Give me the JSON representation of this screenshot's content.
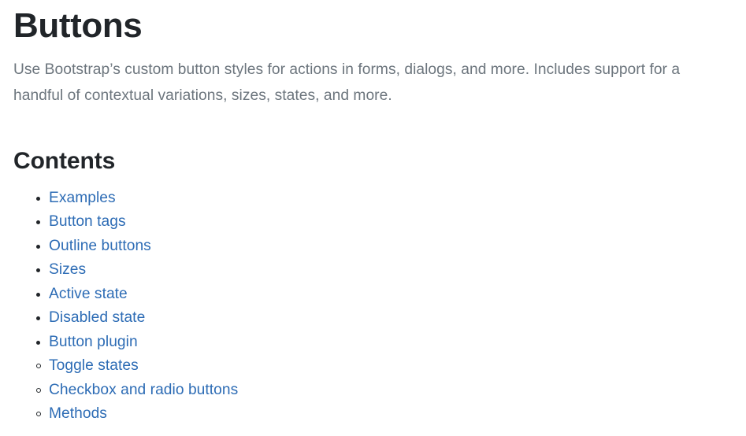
{
  "page": {
    "title": "Buttons",
    "lead": "Use Bootstrap’s custom button styles for actions in forms, dialogs, and more. Includes support for a handful of contextual variations, sizes, states, and more.",
    "background_color": "#ffffff",
    "heading_color": "#212529",
    "lead_color": "#6c757d",
    "link_color": "#2d6cb5"
  },
  "contents": {
    "heading": "Contents",
    "items": [
      {
        "label": "Examples"
      },
      {
        "label": "Button tags"
      },
      {
        "label": "Outline buttons"
      },
      {
        "label": "Sizes"
      },
      {
        "label": "Active state"
      },
      {
        "label": "Disabled state"
      },
      {
        "label": "Button plugin",
        "children": [
          {
            "label": "Toggle states"
          },
          {
            "label": "Checkbox and radio buttons"
          },
          {
            "label": "Methods"
          }
        ]
      }
    ]
  }
}
